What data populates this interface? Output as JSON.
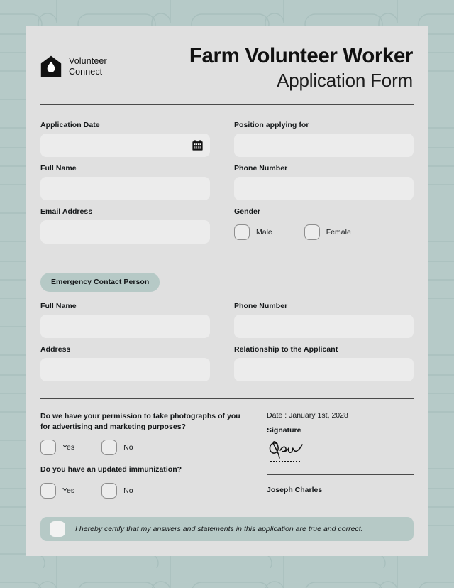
{
  "theme": {
    "page_bg": "#b6cac8",
    "card_bg": "#e0e0e0",
    "input_bg": "#ececec",
    "accent_sage": "#b6c9c6",
    "text": "#15181a",
    "rule": "#4a4a4a"
  },
  "header": {
    "brand_name": "Volunteer\nConnect",
    "logo_icon": "house-droplet-icon",
    "title_main": "Farm Volunteer Worker",
    "title_sub": "Application Form"
  },
  "applicant_section": {
    "fields": [
      {
        "label": "Application Date",
        "value": "",
        "icon": "calendar-icon"
      },
      {
        "label": "Position applying for",
        "value": ""
      },
      {
        "label": "Full Name",
        "value": ""
      },
      {
        "label": "Phone Number",
        "value": ""
      },
      {
        "label": "Email Address",
        "value": ""
      }
    ],
    "gender": {
      "label": "Gender",
      "options": [
        {
          "label": "Male",
          "selected": false
        },
        {
          "label": "Female",
          "selected": false
        }
      ]
    }
  },
  "emergency_section": {
    "badge": "Emergency Contact Person",
    "fields": [
      {
        "label": "Full Name",
        "value": ""
      },
      {
        "label": "Phone Number",
        "value": ""
      },
      {
        "label": "Address",
        "value": ""
      },
      {
        "label": "Relationship to the Applicant",
        "value": ""
      }
    ]
  },
  "questions": [
    {
      "text": "Do we have your permission to take photographs of you for advertising and marketing purposes?",
      "options": [
        {
          "label": "Yes",
          "selected": false
        },
        {
          "label": "No",
          "selected": false
        }
      ]
    },
    {
      "text": "Do you have an updated immunization?",
      "options": [
        {
          "label": "Yes",
          "selected": false
        },
        {
          "label": "No",
          "selected": false
        }
      ]
    }
  ],
  "signature": {
    "date_line": "Date : January 1st, 2028",
    "label": "Signature",
    "mark_icon": "handwritten-signature-icon",
    "name": "Joseph Charles"
  },
  "certification": {
    "checked": false,
    "text": "I hereby certify that my answers and statements in this application are true and correct."
  }
}
